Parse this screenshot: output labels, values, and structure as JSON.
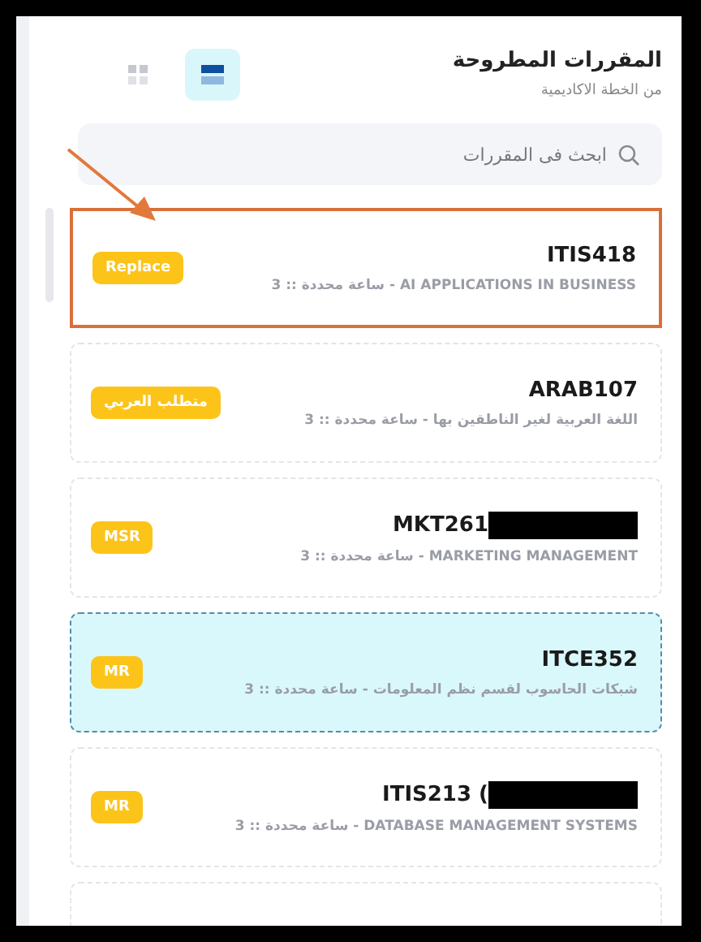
{
  "header": {
    "title": "المقررات المطروحة",
    "subtitle": "من الخطة الاكاديمية"
  },
  "view_toggle": [
    {
      "kind": "grid",
      "selected": false
    },
    {
      "kind": "list",
      "selected": true
    }
  ],
  "search": {
    "placeholder": "ابحث فى المقررات"
  },
  "courses": [
    {
      "code": "ITIS418",
      "redacted": false,
      "subtitle": "AI APPLICATIONS IN BUSINESS - ساعة محددة :: 3",
      "badge": "Replace",
      "selected": false,
      "annotated": true
    },
    {
      "code": "ARAB107",
      "redacted": false,
      "subtitle": "اللغة العربية لغير الناطقين بها - ساعة محددة :: 3",
      "badge": "متطلب العربي",
      "selected": false,
      "annotated": false
    },
    {
      "code": "MKT261",
      "redacted": true,
      "subtitle": "MARKETING MANAGEMENT - ساعة محددة :: 3",
      "badge": "MSR",
      "selected": false,
      "annotated": false
    },
    {
      "code": "ITCE352",
      "redacted": false,
      "subtitle": "شبكات الحاسوب لقسم نظم المعلومات - ساعة محددة :: 3",
      "badge": "MR",
      "selected": true,
      "annotated": false
    },
    {
      "code": "ITIS213 (",
      "redacted": true,
      "subtitle": "DATABASE MANAGEMENT SYSTEMS - ساعة محددة :: 3",
      "badge": "MR",
      "selected": false,
      "annotated": false
    }
  ]
}
